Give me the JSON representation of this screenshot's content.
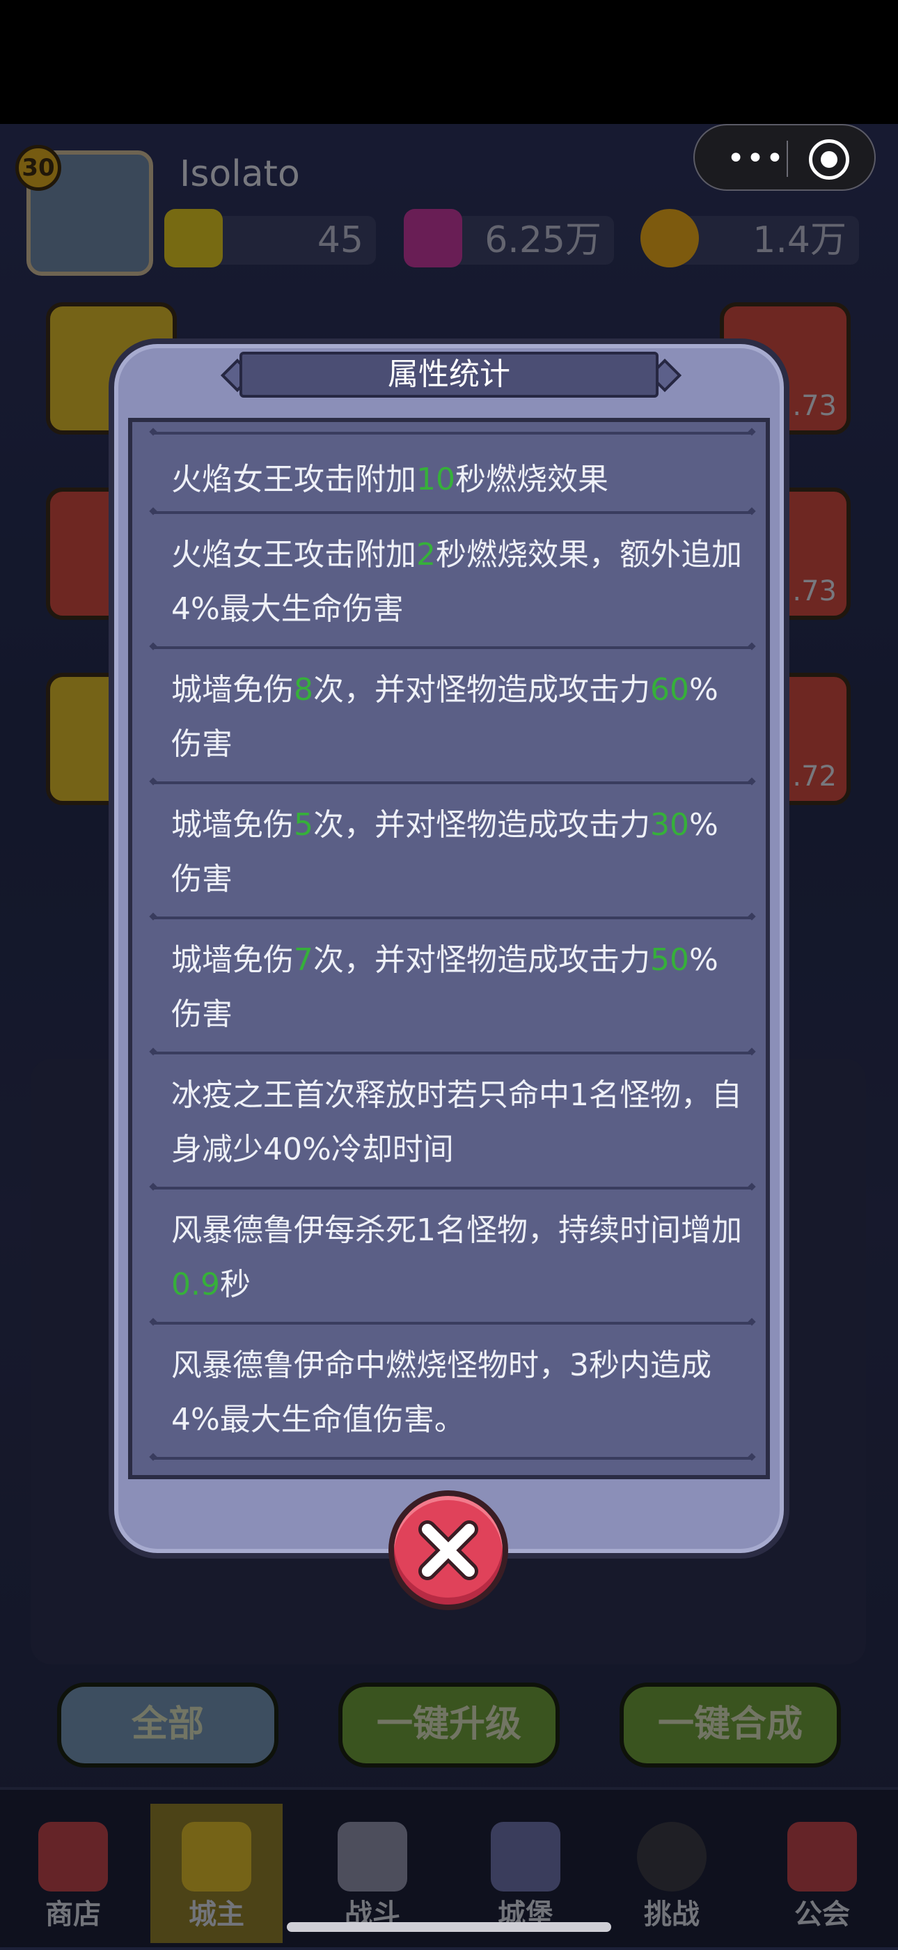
{
  "profile": {
    "level": "30",
    "name": "Isolato",
    "resources": [
      {
        "icon": "gold-gem-icon",
        "value": "45"
      },
      {
        "icon": "purple-crystal-icon",
        "value": "6.25万"
      },
      {
        "icon": "coin-icon",
        "value": "1.4万"
      }
    ]
  },
  "dialog": {
    "title": "属性统计",
    "items": [
      {
        "parts": [
          {
            "t": "火焰女王攻击附加"
          },
          {
            "t": "10",
            "g": true
          },
          {
            "t": "秒燃烧效果"
          }
        ]
      },
      {
        "parts": [
          {
            "t": "火焰女王攻击附加"
          },
          {
            "t": "2",
            "g": true
          },
          {
            "t": "秒燃烧效果，额外追加4%最大生命伤害"
          }
        ]
      },
      {
        "parts": [
          {
            "t": "城墙免伤"
          },
          {
            "t": "8",
            "g": true
          },
          {
            "t": "次，并对怪物造成攻击力"
          },
          {
            "t": "60",
            "g": true
          },
          {
            "t": "%伤害"
          }
        ]
      },
      {
        "parts": [
          {
            "t": "城墙免伤"
          },
          {
            "t": "5",
            "g": true
          },
          {
            "t": "次，并对怪物造成攻击力"
          },
          {
            "t": "30",
            "g": true
          },
          {
            "t": "%伤害"
          }
        ]
      },
      {
        "parts": [
          {
            "t": "城墙免伤"
          },
          {
            "t": "7",
            "g": true
          },
          {
            "t": "次，并对怪物造成攻击力"
          },
          {
            "t": "50",
            "g": true
          },
          {
            "t": "%伤害"
          }
        ]
      },
      {
        "parts": [
          {
            "t": "冰疫之王首次释放时若只命中1名怪物，自身减少40%冷却时间"
          }
        ]
      },
      {
        "parts": [
          {
            "t": "风暴德鲁伊每杀死1名怪物，持续时间增加"
          },
          {
            "t": "0.9",
            "g": true
          },
          {
            "t": "秒"
          }
        ]
      },
      {
        "parts": [
          {
            "t": "风暴德鲁伊命中燃烧怪物时，3秒内造成4%最大生命值伤害。"
          }
        ]
      }
    ],
    "close_icon": "close-icon"
  },
  "side_badges": [
    ".73",
    ".73",
    ".72"
  ],
  "actions": {
    "all": "全部",
    "upgrade": "一键升级",
    "merge": "一键合成"
  },
  "nav": [
    {
      "label": "商店",
      "icon": "shop-icon"
    },
    {
      "label": "城主",
      "icon": "crown-icon"
    },
    {
      "label": "战斗",
      "icon": "swords-icon"
    },
    {
      "label": "城堡",
      "icon": "castle-icon"
    },
    {
      "label": "挑战",
      "icon": "monster-icon"
    },
    {
      "label": "公会",
      "icon": "guild-banner-icon"
    }
  ],
  "colors": {
    "highlight_green": "#36b03a",
    "dialog_bg": "#8b8fb8",
    "list_bg": "#5b5f86",
    "close_red": "#e0425a"
  }
}
